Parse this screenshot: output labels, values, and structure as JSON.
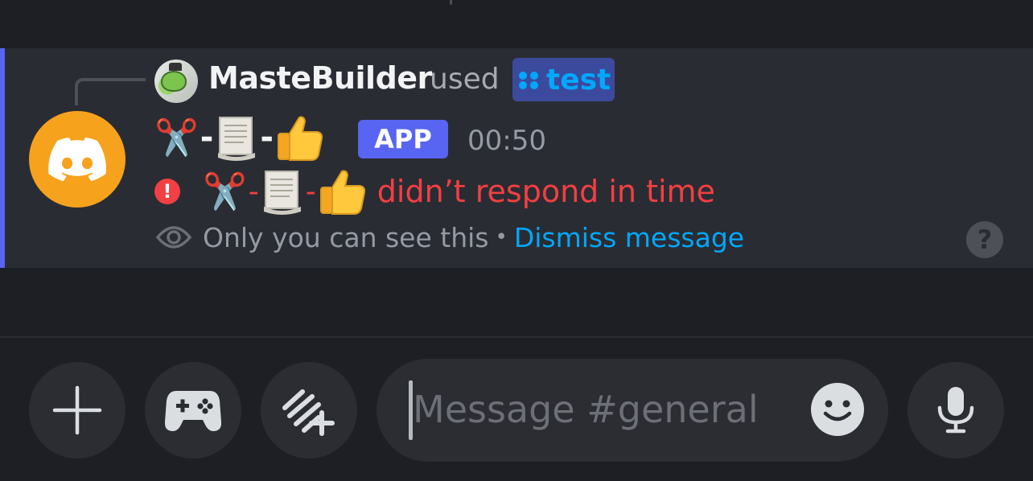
{
  "colors": {
    "background": "#1e1f24",
    "message_highlight": "#2a2c33",
    "accent_bar": "#5865f2",
    "bot_avatar": "#f7a21d",
    "error": "#f23f43",
    "link": "#00a8fc"
  },
  "interaction": {
    "username": "MasteBuilder",
    "used_text": "used",
    "command_icon": "slash-command-icon",
    "command_name": "test"
  },
  "message": {
    "bot_avatar_icon": "discord-logo-icon",
    "bot_name_emoji": [
      "✂️",
      "📃",
      "👍"
    ],
    "app_badge": "APP",
    "timestamp": "00:50",
    "error_icon": "!",
    "error_text": "didn’t respond in time",
    "ephemeral_icon": "eye-icon",
    "ephemeral_text": "Only you can see this",
    "separator": "•",
    "dismiss_label": "Dismiss message",
    "help_label": "?"
  },
  "composer": {
    "add_icon": "plus-icon",
    "activities_icon": "gamepad-icon",
    "apps_icon": "app-launcher-icon",
    "placeholder": "Message #general",
    "emoji_icon": "smiley-icon",
    "voice_icon": "microphone-icon"
  }
}
